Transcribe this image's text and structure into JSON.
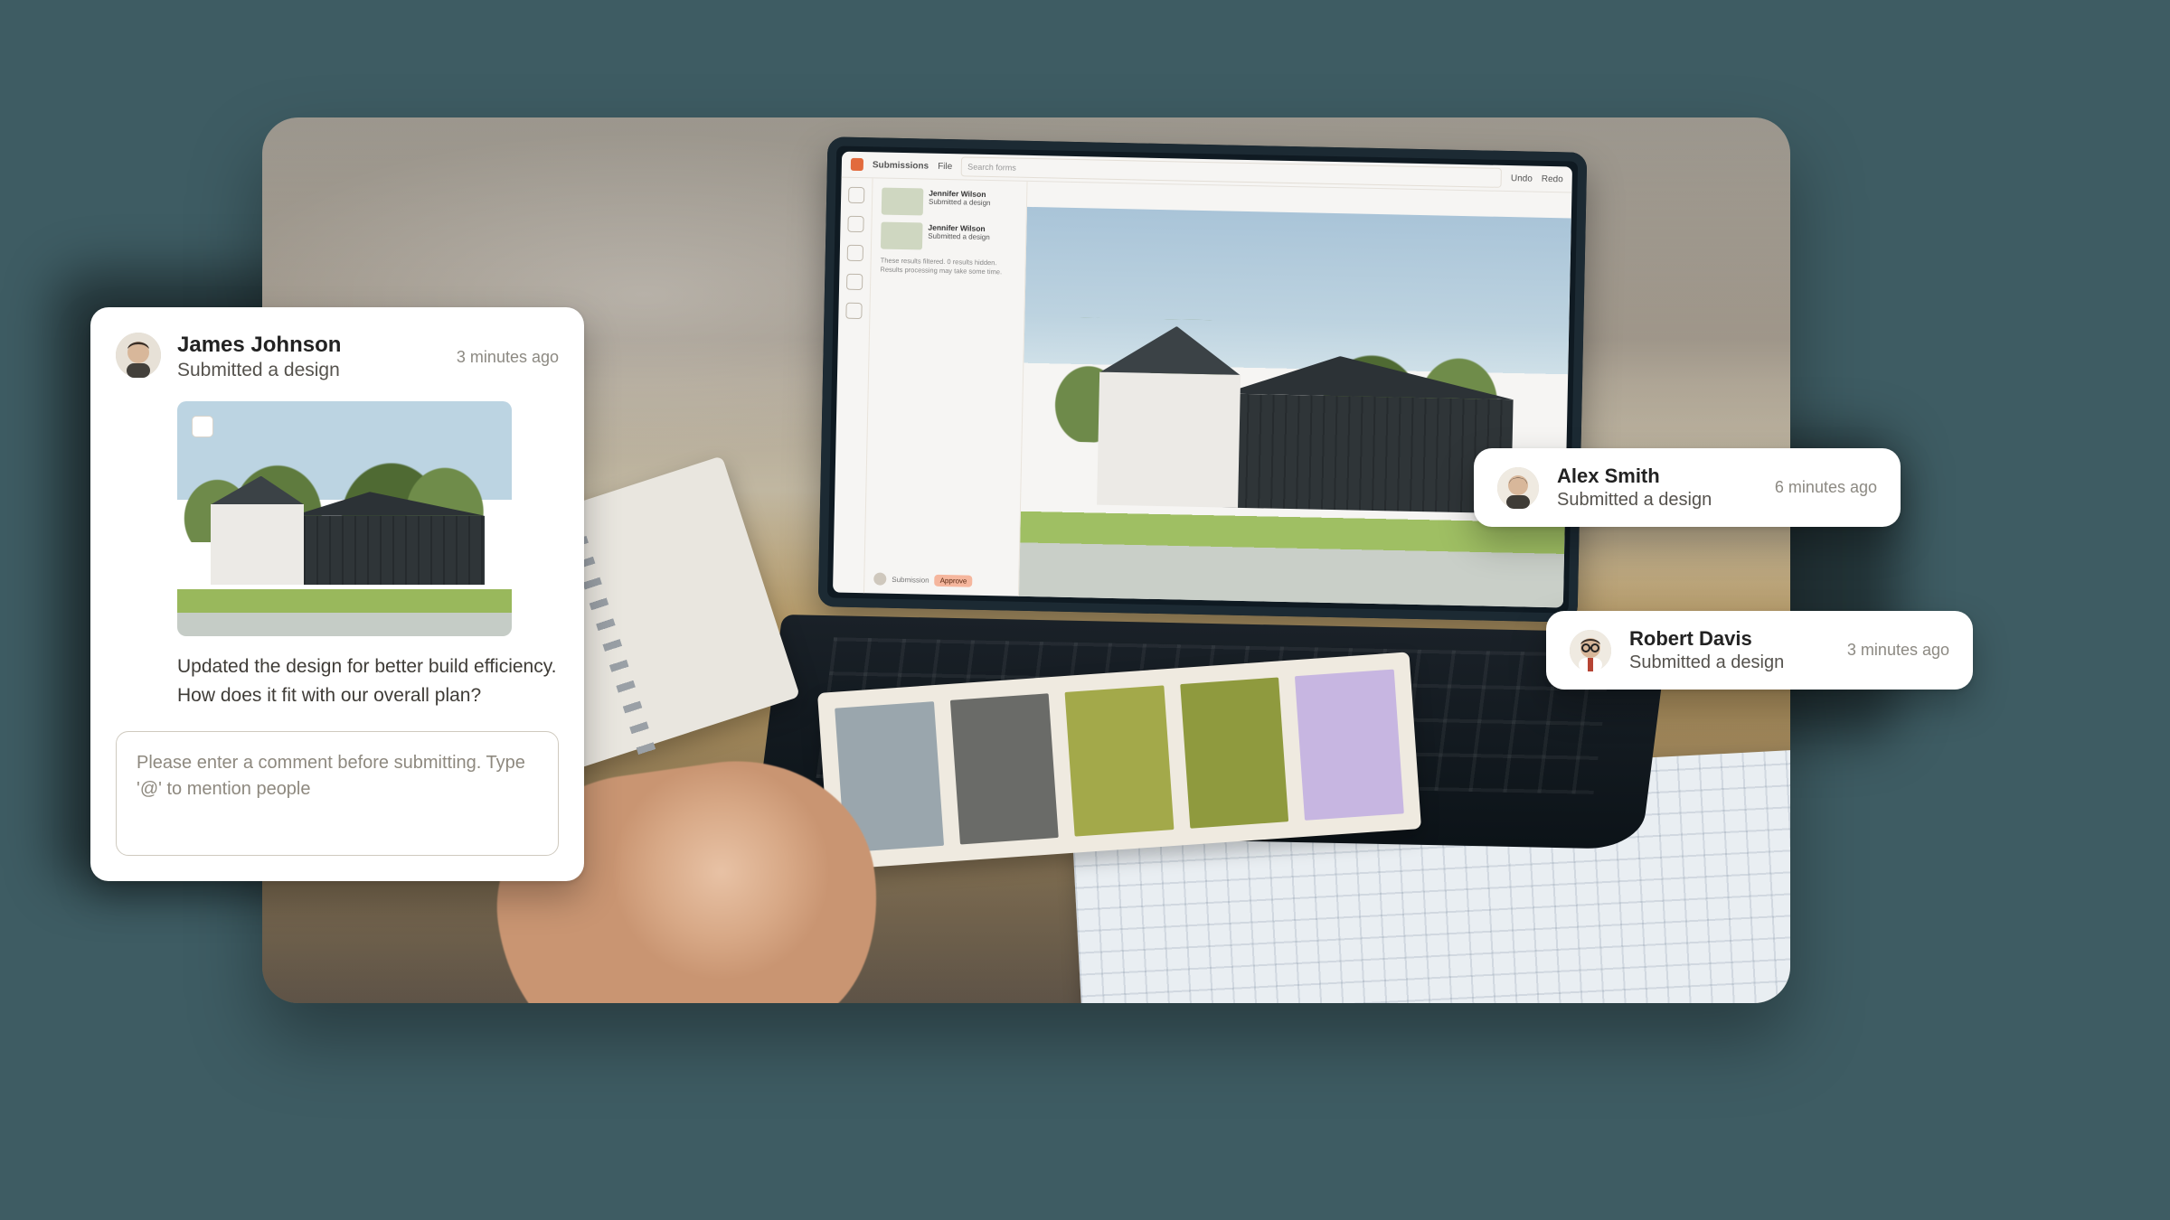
{
  "colors": {
    "page_bg": "#3e5c63",
    "accent": "#e26a3c",
    "swatches": [
      "#9aa6ad",
      "#6a6b68",
      "#a3a94a",
      "#8f9a3e",
      "#c7b6e1"
    ]
  },
  "laptop_app": {
    "title": "Submissions",
    "file_label": "File",
    "search_placeholder": "Search forms",
    "undo": "Undo",
    "redo": "Redo",
    "sidebar": {
      "items": [
        {
          "author": "Jennifer Wilson",
          "subtitle": "Submitted a design"
        },
        {
          "author": "Jennifer Wilson",
          "subtitle": "Submitted a design"
        }
      ],
      "footnote": "These results filtered. 0 results hidden. Results processing may take some time.",
      "footer_tag": "Submission",
      "footer_button": "Approve"
    }
  },
  "main_card": {
    "author": "James Johnson",
    "subtitle": "Submitted a design",
    "time": "3 minutes ago",
    "body": "Updated the design for better build efficiency. How does it fit with our overall plan?",
    "comment_placeholder": "Please enter a comment before submitting. Type '@' to mention people"
  },
  "toasts": [
    {
      "author": "Alex Smith",
      "subtitle": "Submitted a design",
      "time": "6 minutes ago"
    },
    {
      "author": "Robert Davis",
      "subtitle": "Submitted a design",
      "time": "3 minutes ago"
    }
  ]
}
